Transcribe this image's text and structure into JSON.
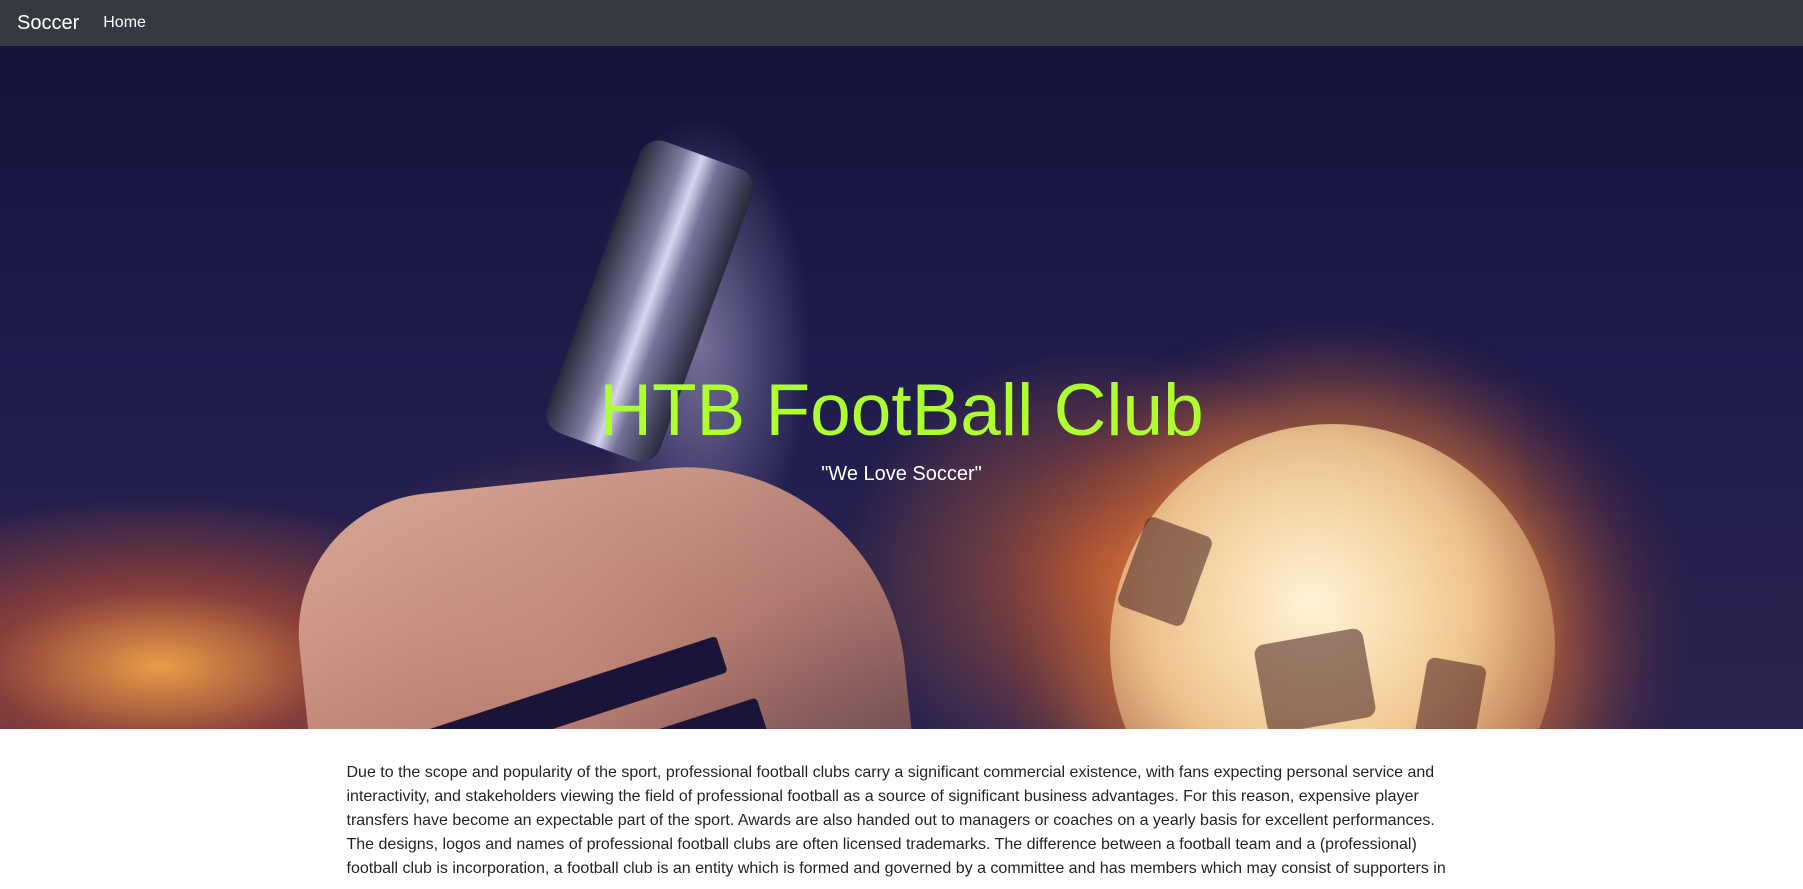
{
  "navbar": {
    "brand": "Soccer",
    "links": [
      {
        "label": "Home"
      }
    ]
  },
  "hero": {
    "title": "HTB FootBall Club",
    "tagline": "\"We Love Soccer\""
  },
  "main": {
    "paragraph": "Due to the scope and popularity of the sport, professional football clubs carry a significant commercial existence, with fans expecting personal service and interactivity, and stakeholders viewing the field of professional football as a source of significant business advantages. For this reason, expensive player transfers have become an expectable part of the sport. Awards are also handed out to managers or coaches on a yearly basis for excellent performances. The designs, logos and names of professional football clubs are often licensed trademarks. The difference between a football team and a (professional) football club is incorporation, a football club is an entity which is formed and governed by a committee and has members which may consist of supporters in"
  },
  "colors": {
    "navbar": "#343a40",
    "hero_title": "#adff2f",
    "text": "#212529"
  }
}
